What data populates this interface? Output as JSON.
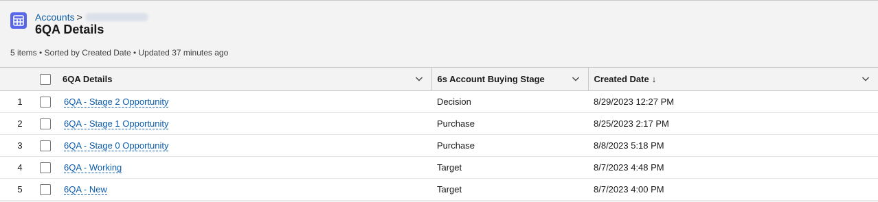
{
  "header": {
    "breadcrumb_parent": "Accounts",
    "breadcrumb_separator": ">",
    "title": "6QA Details",
    "meta": "5 items • Sorted by Created Date • Updated 37 minutes ago",
    "icon": "table-icon",
    "icon_color": "#5867e8"
  },
  "table": {
    "columns": {
      "name": "6QA Details",
      "stage": "6s Account Buying Stage",
      "created": "Created Date",
      "sort_arrow": "↓"
    },
    "rows": [
      {
        "num": "1",
        "name": "6QA - Stage 2 Opportunity",
        "stage": "Decision",
        "created": "8/29/2023 12:27 PM"
      },
      {
        "num": "2",
        "name": "6QA - Stage 1 Opportunity",
        "stage": "Purchase",
        "created": "8/25/2023 2:17 PM"
      },
      {
        "num": "3",
        "name": "6QA - Stage 0 Opportunity",
        "stage": "Purchase",
        "created": "8/8/2023 5:18 PM"
      },
      {
        "num": "4",
        "name": "6QA - Working",
        "stage": "Target",
        "created": "8/7/2023 4:48 PM"
      },
      {
        "num": "5",
        "name": "6QA - New",
        "stage": "Target",
        "created": "8/7/2023 4:00 PM"
      }
    ]
  },
  "colors": {
    "link": "#0b5cab",
    "header_bg": "#f3f3f3"
  }
}
